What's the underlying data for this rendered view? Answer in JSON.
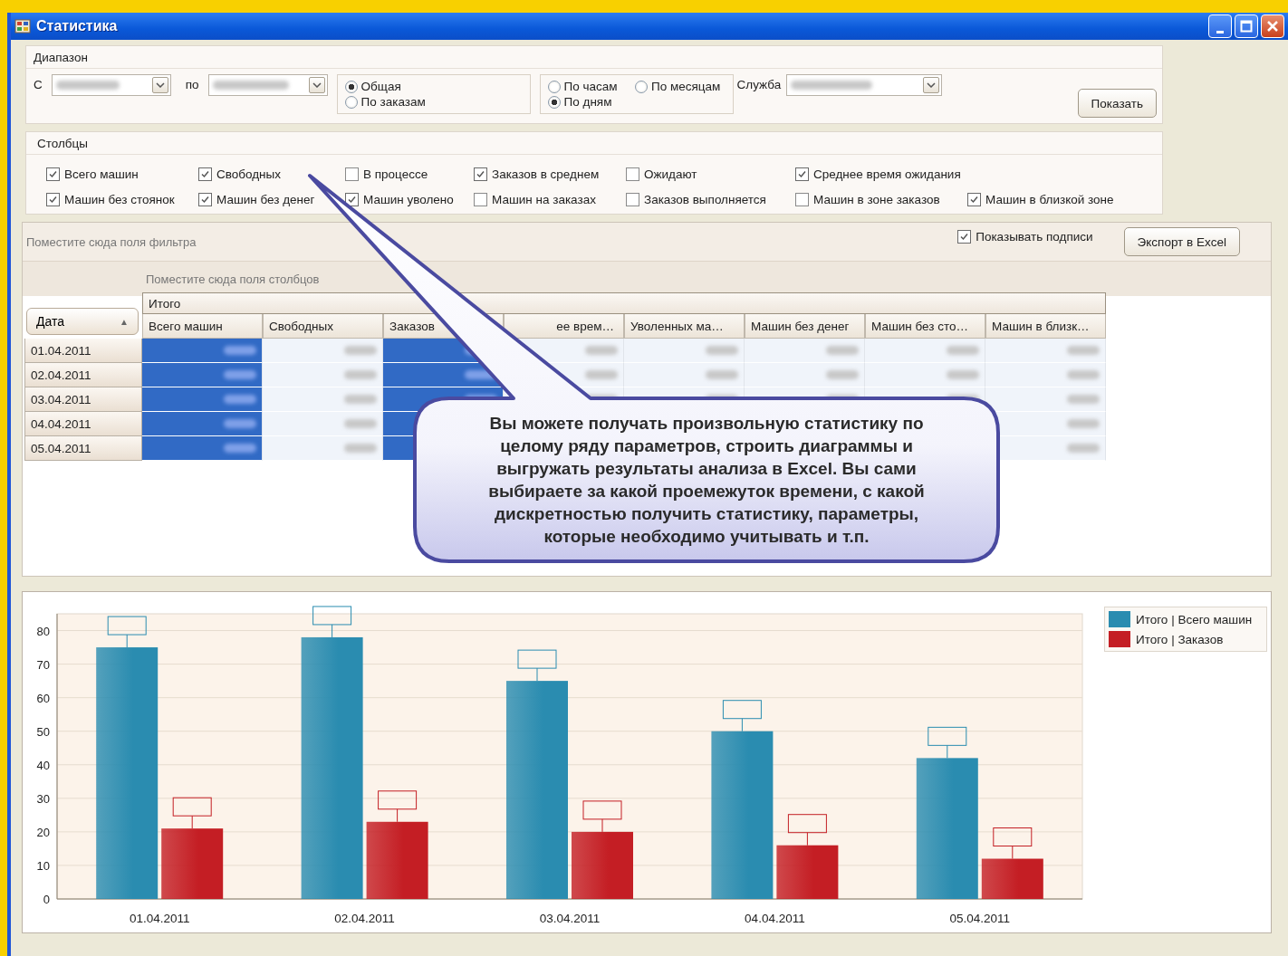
{
  "window": {
    "title": "Статистика"
  },
  "range": {
    "title": "Диапазон",
    "from_label": "С",
    "to_label": "по",
    "service_label": "Служба",
    "show_button": "Показать",
    "mode": [
      {
        "label": "Общая",
        "selected": true
      },
      {
        "label": "По заказам",
        "selected": false
      }
    ],
    "granularity": [
      {
        "label": "По часам",
        "selected": false
      },
      {
        "label": "По месяцам",
        "selected": false
      },
      {
        "label": "По дням",
        "selected": true
      }
    ]
  },
  "columns_group": {
    "title": "Столбцы",
    "items": [
      {
        "label": "Всего машин",
        "checked": true
      },
      {
        "label": "Свободных",
        "checked": true
      },
      {
        "label": "В процессе",
        "checked": false
      },
      {
        "label": "Заказов в среднем",
        "checked": true
      },
      {
        "label": "Ожидают",
        "checked": false
      },
      {
        "label": "Среднее время ожидания",
        "checked": true
      },
      {
        "label": "Машин без стоянок",
        "checked": true
      },
      {
        "label": "Машин без денег",
        "checked": true
      },
      {
        "label": "Машин уволено",
        "checked": true
      },
      {
        "label": "Машин на заказах",
        "checked": false
      },
      {
        "label": "Заказов выполняется",
        "checked": false
      },
      {
        "label": "Машин в зоне заказов",
        "checked": false
      },
      {
        "label": "Машин в близкой зоне",
        "checked": true
      }
    ]
  },
  "pivot": {
    "filter_hint": "Поместите сюда поля фильтра",
    "show_labels": {
      "label": "Показывать подписи",
      "checked": true
    },
    "export_button": "Экспорт в Excel",
    "column_hint": "Поместите сюда поля столбцов",
    "row_field": "Дата",
    "sort_icon": "▲",
    "group_header": "Итого",
    "columns": [
      {
        "label": "Всего машин",
        "selected": true
      },
      {
        "label": "Свободных",
        "selected": false
      },
      {
        "label": "Заказов",
        "selected": true
      },
      {
        "label": "ее врем…",
        "selected": false
      },
      {
        "label": "Уволенных ма…",
        "selected": false
      },
      {
        "label": "Машин без денег",
        "selected": false
      },
      {
        "label": "Машин без сто…",
        "selected": false
      },
      {
        "label": "Машин в близк…",
        "selected": false
      }
    ],
    "rows": [
      "01.04.2011",
      "02.04.2011",
      "03.04.2011",
      "04.04.2011",
      "05.04.2011"
    ]
  },
  "callout": "Вы можете получать произвольную статистику по целому ряду параметров, строить диаграммы и выгружать результаты анализа в Excel. Вы сами выбираете за какой проемежуток времени, с какой дискретностью получить статистику, параметры, которые необходимо учитывать и т.п.",
  "chart": {
    "chart_data": {
      "type": "bar",
      "grid": true,
      "categories": [
        "01.04.2011",
        "02.04.2011",
        "03.04.2011",
        "04.04.2011",
        "05.04.2011"
      ],
      "ylim": [
        0,
        85
      ],
      "yticks": [
        0,
        10,
        20,
        30,
        40,
        50,
        60,
        70,
        80
      ],
      "series": [
        {
          "name": "Итого | Всего машин",
          "color": "#2a8cb0",
          "values": [
            75,
            78,
            65,
            50,
            42
          ]
        },
        {
          "name": "Итого | Заказов",
          "color": "#c41e24",
          "values": [
            21,
            23,
            20,
            16,
            12
          ]
        }
      ]
    }
  }
}
